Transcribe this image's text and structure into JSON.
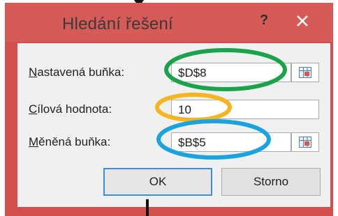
{
  "dialog": {
    "title": "Hledání řešení",
    "help_label": "?",
    "close_icon": "close-icon",
    "title_bar_color": "#d65a56"
  },
  "fields": {
    "set_cell": {
      "label_underlined": "N",
      "label_rest": "astavená buňka:",
      "value": "$D$8"
    },
    "target_value": {
      "label_underlined": "C",
      "label_rest": "ílová hodnota:",
      "value": "10"
    },
    "changing_cell": {
      "label_underlined": "M",
      "label_rest": "ěněná buňka:",
      "value": "$B$5"
    }
  },
  "buttons": {
    "ok_label": "OK",
    "cancel_label": "Storno"
  },
  "annotations": {
    "set_cell_highlight": "#1aa34a",
    "target_value_highlight": "#f5b521",
    "changing_cell_highlight": "#1aa3de"
  }
}
